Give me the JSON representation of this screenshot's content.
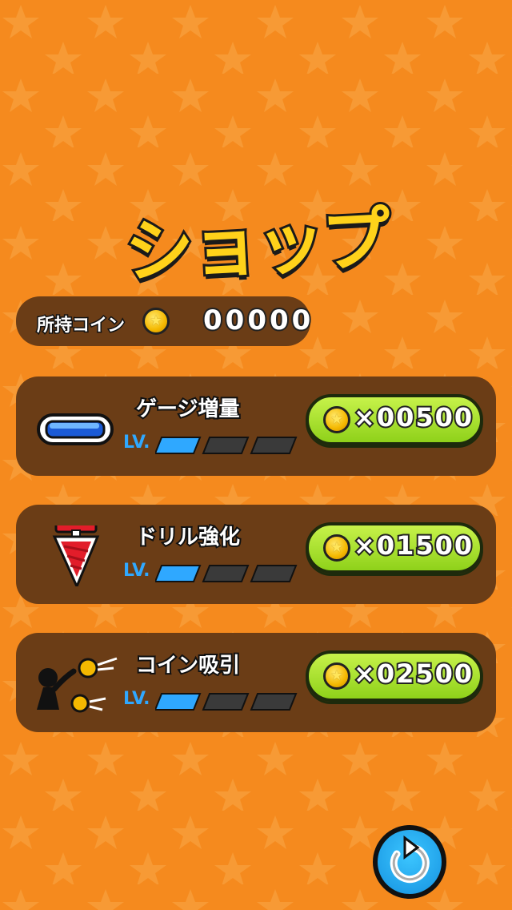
{
  "title": "ショップ",
  "coins": {
    "label": "所持コイン",
    "value": "00000"
  },
  "items": [
    {
      "name": "ゲージ増量",
      "level_label": "LV.",
      "level": 1,
      "max_level": 3,
      "price": "×00500",
      "icon": "gauge-icon"
    },
    {
      "name": "ドリル強化",
      "level_label": "LV.",
      "level": 1,
      "max_level": 3,
      "price": "×01500",
      "icon": "drill-icon"
    },
    {
      "name": "コイン吸引",
      "level_label": "LV.",
      "level": 1,
      "max_level": 3,
      "price": "×02500",
      "icon": "coin-magnet-icon"
    }
  ],
  "back_button": {
    "icon": "back-arrow-icon"
  },
  "colors": {
    "background": "#f58a1e",
    "panel": "#6b3d16",
    "button": "#a6e12a",
    "level_on": "#2fa8ff",
    "level_off": "#3a3a3a"
  }
}
